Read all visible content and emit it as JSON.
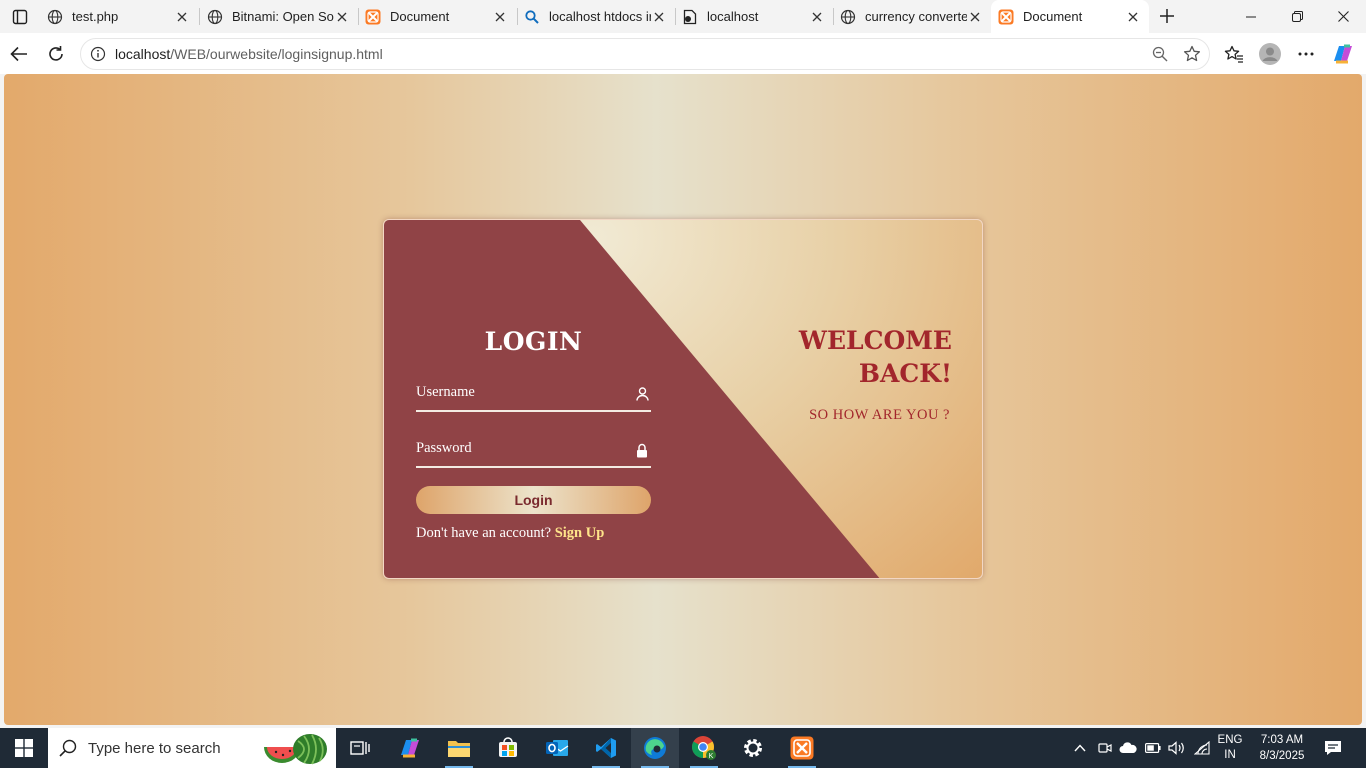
{
  "browser": {
    "tabs": [
      {
        "title": "test.php",
        "icon": "globe-icon"
      },
      {
        "title": "Bitnami: Open Sou",
        "icon": "globe-icon"
      },
      {
        "title": "Document",
        "icon": "xampp-icon"
      },
      {
        "title": "localhost htdocs ir",
        "icon": "search-icon"
      },
      {
        "title": "localhost",
        "icon": "page-icon"
      },
      {
        "title": "currency converte",
        "icon": "globe-icon"
      },
      {
        "title": "Document",
        "icon": "xampp-icon",
        "active": true
      }
    ],
    "url_host": "localhost",
    "url_path": "/WEB/ourwebsite/loginsignup.html"
  },
  "page": {
    "login_title": "LOGIN",
    "username_label": "Username",
    "password_label": "Password",
    "login_button": "Login",
    "signup_prompt": "Don't have an account?",
    "signup_link": "Sign Up",
    "welcome_line1": "WELCOME",
    "welcome_line2": "BACK!",
    "welcome_sub": "SO HOW ARE YOU ?"
  },
  "taskbar": {
    "search_placeholder": "Type here to search",
    "apps": [
      "copilot-icon",
      "file-explorer-icon",
      "store-icon",
      "outlook-icon",
      "vscode-icon",
      "edge-icon",
      "chrome-icon",
      "settings-icon",
      "xampp-icon"
    ],
    "active_app": "edge-icon",
    "language_line1": "ENG",
    "language_line2": "IN",
    "time": "7:03 AM",
    "date": "8/3/2025"
  },
  "colors": {
    "card_maroon": "#904346",
    "accent_red": "#a2262c",
    "link_yellow": "#ffe48a",
    "edge_blue": "#0f7bd6"
  }
}
